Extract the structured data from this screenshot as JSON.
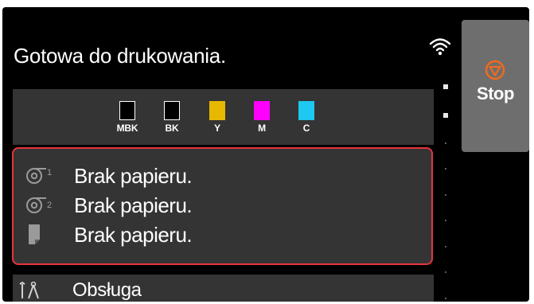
{
  "status": {
    "title": "Gotowa do drukowania."
  },
  "inks": [
    {
      "label": "MBK",
      "color": "#000000"
    },
    {
      "label": "BK",
      "color": "#000000"
    },
    {
      "label": "Y",
      "color": "#e6b800"
    },
    {
      "label": "M",
      "color": "#ff00ff"
    },
    {
      "label": "C",
      "color": "#1ec8f0"
    }
  ],
  "paper_alerts": {
    "border_color": "#e8343c",
    "items": [
      {
        "icon": "roll-1-icon",
        "roll_number": "1",
        "text": "Brak papieru."
      },
      {
        "icon": "roll-2-icon",
        "roll_number": "2",
        "text": "Brak papieru."
      },
      {
        "icon": "cut-sheet-icon",
        "text": "Brak papieru."
      }
    ]
  },
  "menu": {
    "maintenance_label": "Obsługa",
    "maintenance_icon": "tools-icon"
  },
  "stop": {
    "label": "Stop",
    "icon": "stop-icon",
    "icon_color": "#f26a1b"
  },
  "connection": {
    "icon": "wifi-icon"
  }
}
